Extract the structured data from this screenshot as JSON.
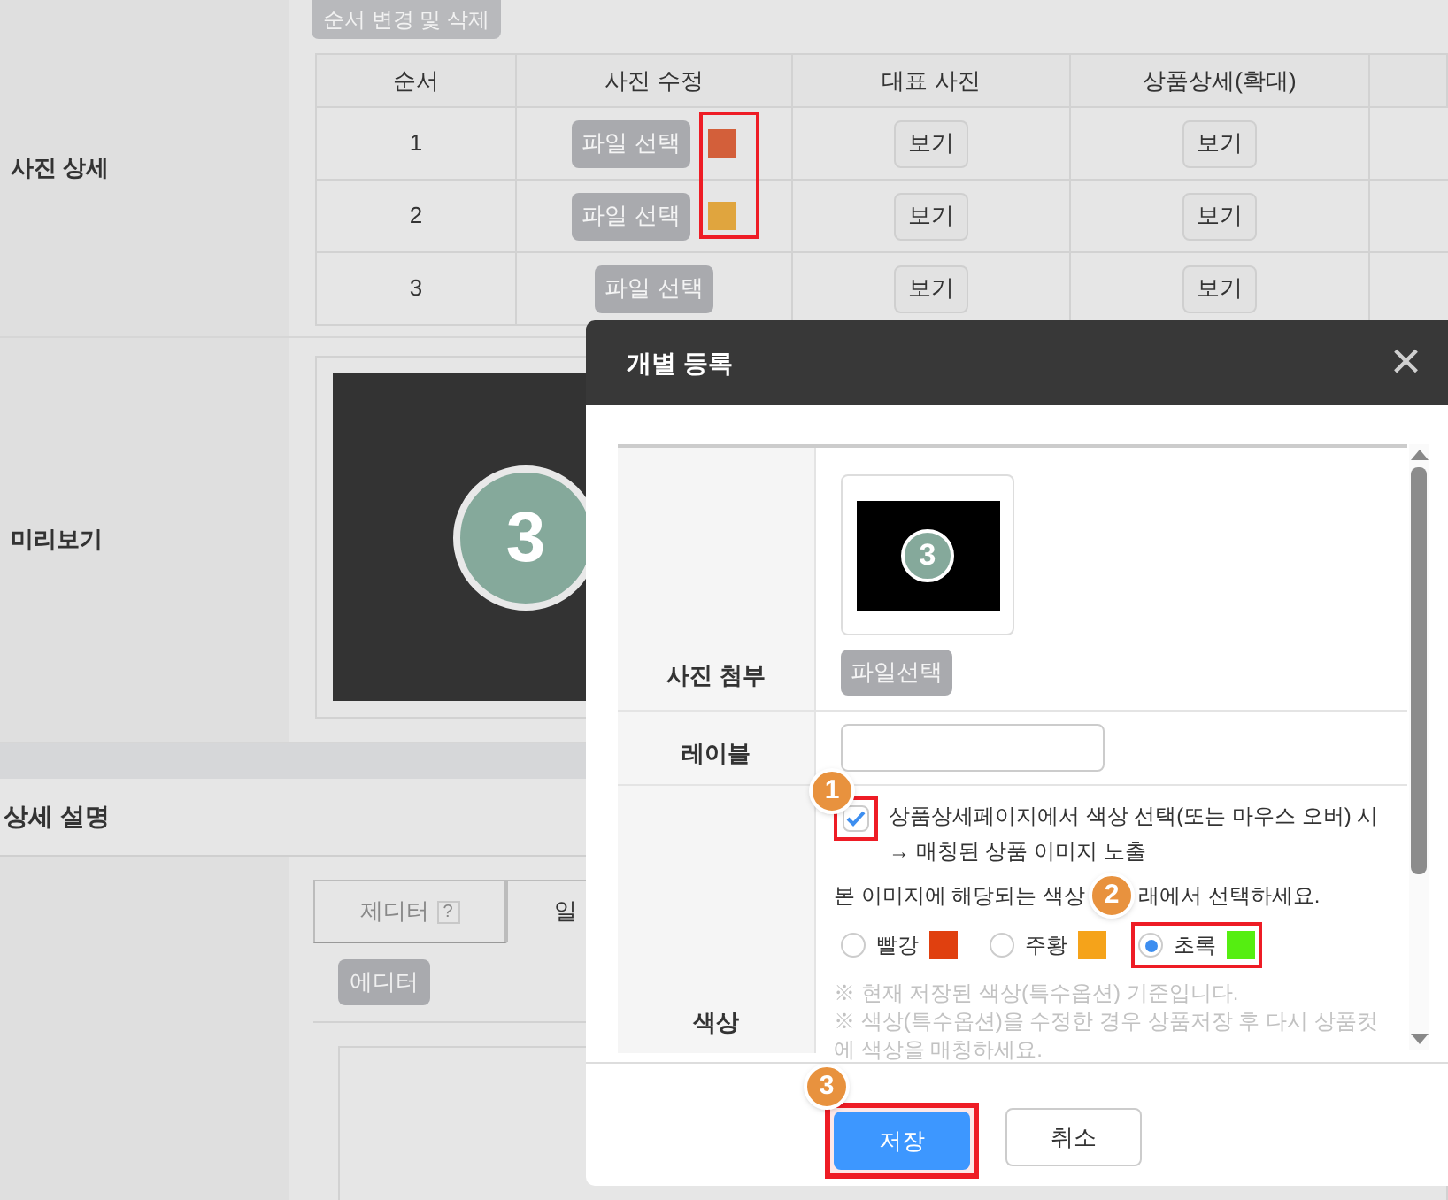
{
  "photo_detail": {
    "label": "사진 상세",
    "reorder_button": "순서 변경 및 삭제",
    "columns": [
      "순서",
      "사진 수정",
      "대표 사진",
      "상품상세(확대)"
    ],
    "swatches_highlighted": true,
    "rows": [
      {
        "order": "1",
        "file_button": "파일 선택",
        "color": "#d35f3a",
        "main_photo": "보기",
        "detail_zoom": "보기"
      },
      {
        "order": "2",
        "file_button": "파일 선택",
        "color": "#e0a53e",
        "main_photo": "보기",
        "detail_zoom": "보기"
      },
      {
        "order": "3",
        "file_button": "파일 선택",
        "main_photo": "보기",
        "detail_zoom": "보기"
      }
    ]
  },
  "preview": {
    "label": "미리보기",
    "badge": "3"
  },
  "description": {
    "heading": "상세 설명",
    "tabs": [
      {
        "label": "제디터",
        "help": "?",
        "selected": false
      },
      {
        "label": "일",
        "selected": true
      }
    ],
    "editor_button": "에디터"
  },
  "dialog": {
    "title": "개별 등록",
    "close": "×",
    "photo": {
      "label": "사진 첨부",
      "badge": "3",
      "file_button": "파일선택"
    },
    "label_field": {
      "label": "레이블"
    },
    "color": {
      "label": "색상",
      "checkbox": {
        "checked": true,
        "highlighted": true,
        "step": "1",
        "lines": [
          "상품상세페이지에서 색상 선택(또는 마우스 오버) 시",
          "→ 매칭된 상품 이미지 노출"
        ]
      },
      "prompt_before": "본 이미지에 해당되는 색상",
      "prompt_step": "2",
      "prompt_after": "래에서 선택하세요.",
      "options": [
        {
          "label": "빨강",
          "color": "#e0400f",
          "selected": false,
          "highlighted": false
        },
        {
          "label": "주황",
          "color": "#f5a31a",
          "selected": false,
          "highlighted": false
        },
        {
          "label": "초록",
          "color": "#55ee11",
          "selected": true,
          "highlighted": true
        }
      ],
      "notes": [
        "※ 현재 저장된 색상(특수옵션) 기준입니다.",
        "※ 색상(특수옵션)을 수정한 경우 상품저장 후 다시 상품컷에 색상을 매칭하세요."
      ]
    },
    "buttons": [
      {
        "label": "저장",
        "kind": "primary",
        "highlighted": true,
        "step": "3"
      },
      {
        "label": "취소",
        "kind": "secondary",
        "highlighted": false
      }
    ]
  }
}
